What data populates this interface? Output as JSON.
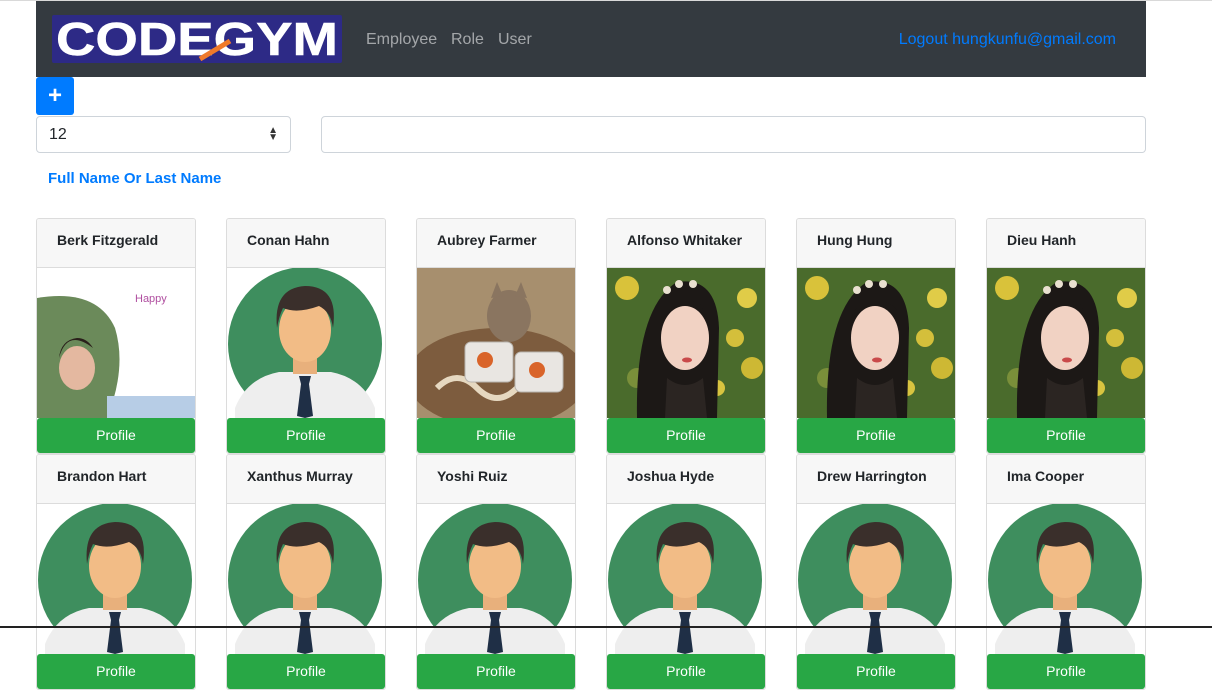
{
  "navbar": {
    "logo_text": "CODEGYM",
    "links": [
      "Employee",
      "Role",
      "User"
    ],
    "logout": "Logout hungkunfu@gmail.com"
  },
  "controls": {
    "add_button": "+",
    "page_size": "12",
    "search_placeholder": "",
    "search_label": "Full Name Or Last Name"
  },
  "cards": [
    {
      "name": "Berk Fitzgerald",
      "image": "photo-happy-woman",
      "button": "Profile"
    },
    {
      "name": "Conan Hahn",
      "image": "default-avatar",
      "button": "Profile"
    },
    {
      "name": "Aubrey Farmer",
      "image": "photo-cat",
      "button": "Profile"
    },
    {
      "name": "Alfonso Whitaker",
      "image": "photo-girl-flowers",
      "button": "Profile"
    },
    {
      "name": "Hung Hung",
      "image": "photo-girl-flowers",
      "button": "Profile"
    },
    {
      "name": "Dieu Hanh",
      "image": "photo-girl-flowers",
      "button": "Profile"
    },
    {
      "name": "Brandon Hart",
      "image": "default-avatar",
      "button": "Profile"
    },
    {
      "name": "Xanthus Murray",
      "image": "default-avatar",
      "button": "Profile"
    },
    {
      "name": "Yoshi Ruiz",
      "image": "default-avatar",
      "button": "Profile"
    },
    {
      "name": "Joshua Hyde",
      "image": "default-avatar",
      "button": "Profile"
    },
    {
      "name": "Drew Harrington",
      "image": "default-avatar",
      "button": "Profile"
    },
    {
      "name": "Ima Cooper",
      "image": "default-avatar",
      "button": "Profile"
    }
  ],
  "happy_photo_text": "Happy",
  "colors": {
    "navbar": "#343a40",
    "primary": "#007bff",
    "success": "#28a745",
    "avatar_bg": "#3e8e5e"
  }
}
